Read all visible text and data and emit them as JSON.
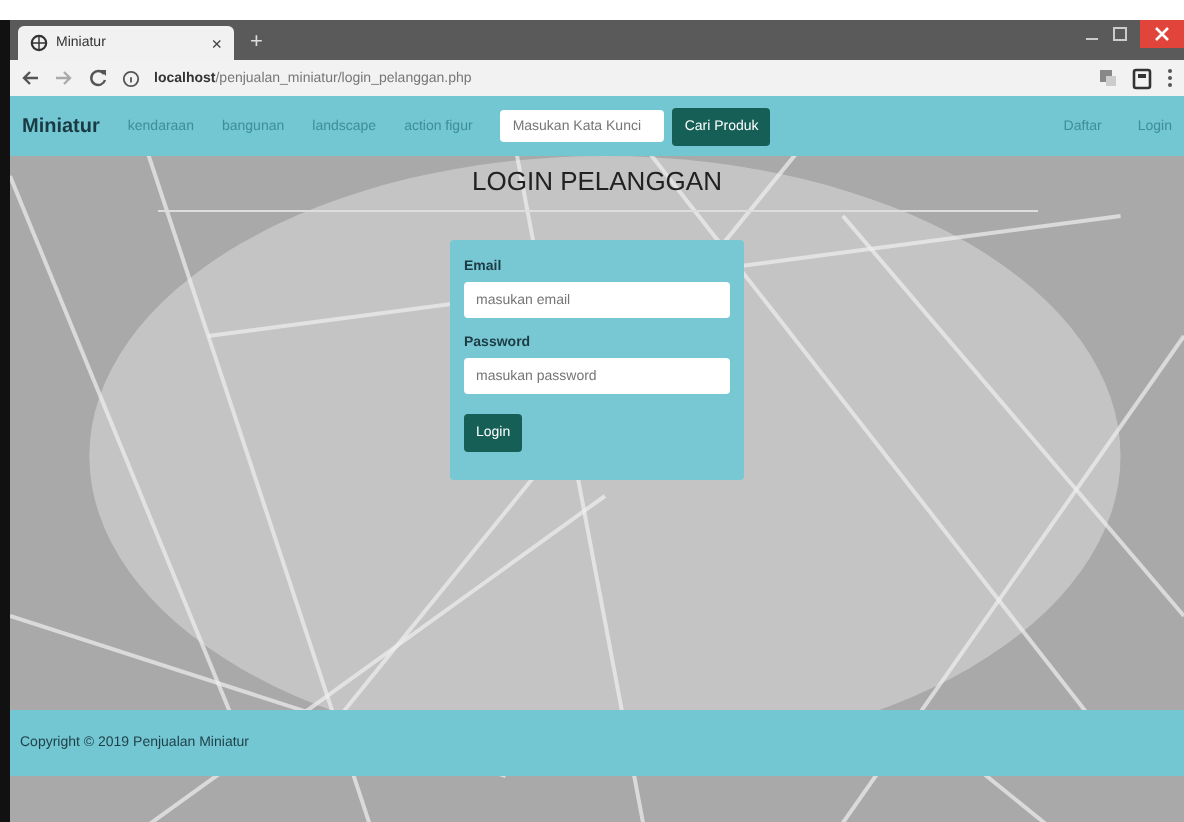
{
  "browser": {
    "tab_title": "Miniatur",
    "tab_close": "×",
    "new_tab": "+",
    "url_host": "localhost",
    "url_path": "/penjualan_miniatur/login_pelanggan.php"
  },
  "navbar": {
    "brand": "Miniatur",
    "links": [
      {
        "label": "kendaraan"
      },
      {
        "label": "bangunan"
      },
      {
        "label": "landscape"
      },
      {
        "label": "action figur"
      }
    ],
    "search": {
      "placeholder": "Masukan Kata Kunci"
    },
    "search_button": "Cari Produk",
    "right_links": [
      {
        "label": "Daftar"
      },
      {
        "label": "Login"
      }
    ]
  },
  "page": {
    "title": "LOGIN PELANGGAN"
  },
  "form": {
    "fields": [
      {
        "label": "Email",
        "placeholder": "masukan email"
      },
      {
        "label": "Password",
        "placeholder": "masukan password"
      }
    ],
    "submit": "Login"
  },
  "footer": {
    "text": "Copyright © 2019 Penjualan Miniatur"
  }
}
